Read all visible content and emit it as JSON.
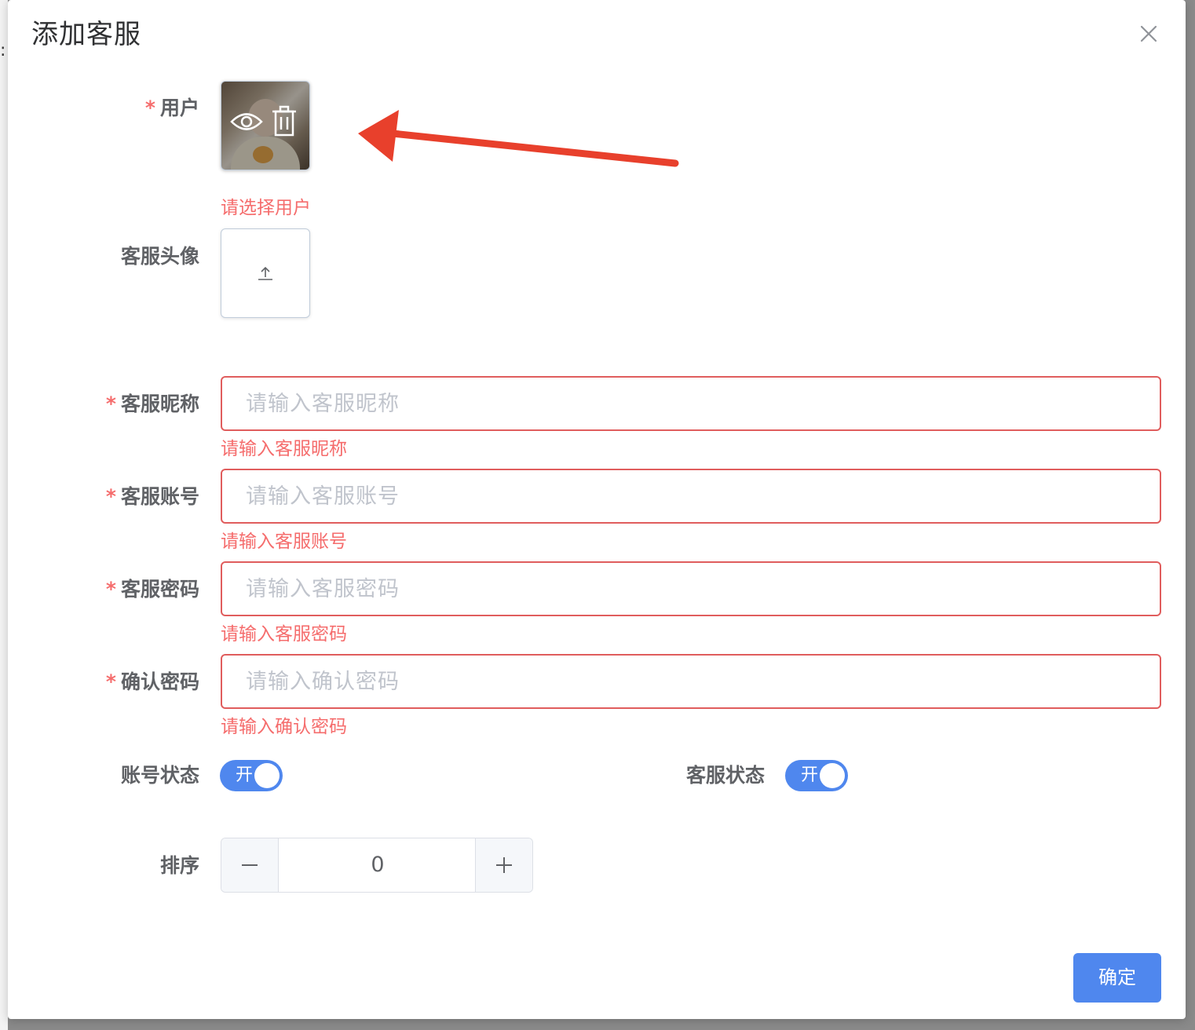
{
  "dialog": {
    "title": "添加客服",
    "close_icon": "close-icon"
  },
  "background": {
    "colon": ":"
  },
  "form": {
    "user": {
      "label": "用户",
      "required": "*",
      "error": "请选择用户",
      "preview_icon": "eye-icon",
      "delete_icon": "trash-icon"
    },
    "avatar": {
      "label": "客服头像",
      "upload_icon": "upload-icon"
    },
    "nickname": {
      "label": "客服昵称",
      "required": "*",
      "placeholder": "请输入客服昵称",
      "error": "请输入客服昵称"
    },
    "account": {
      "label": "客服账号",
      "required": "*",
      "placeholder": "请输入客服账号",
      "error": "请输入客服账号"
    },
    "password": {
      "label": "客服密码",
      "required": "*",
      "placeholder": "请输入客服密码",
      "error": "请输入客服密码"
    },
    "confirm_password": {
      "label": "确认密码",
      "required": "*",
      "placeholder": "请输入确认密码",
      "error": "请输入确认密码"
    },
    "account_status": {
      "label": "账号状态",
      "switch_text": "开",
      "on": true
    },
    "service_status": {
      "label": "客服状态",
      "switch_text": "开",
      "on": true
    },
    "sort": {
      "label": "排序",
      "value": "0",
      "minus_icon": "minus-icon",
      "plus_icon": "plus-icon"
    }
  },
  "footer": {
    "confirm_label": "确定"
  },
  "colors": {
    "primary": "#4f87ee",
    "error": "#f56c6c",
    "annotation_arrow": "#e8402c"
  }
}
